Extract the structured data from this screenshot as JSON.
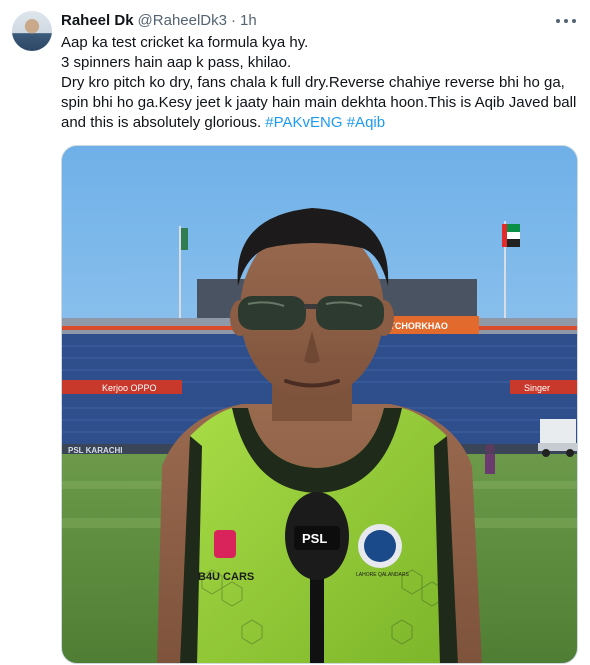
{
  "tweet": {
    "author_name": "Raheel Dk",
    "author_handle": "@RaheelDk3",
    "separator": "·",
    "time": "1h",
    "lines": [
      "Aap ka test cricket ka formula kya hy.",
      "3 spinners hain aap k pass, khilao.",
      "Dry kro pitch ko dry, fans chala k full dry.Reverse chahiye reverse bhi ho ga, spin bhi ho ga.Kesy jeet k jaaty hain main dekhta hoon.This is Aqib Javed ball and this is absolutely glorious."
    ],
    "hashtags": [
      "#PAKvENG",
      "#Aqib"
    ]
  },
  "media": {
    "stand_banner": "#MATCHORKHAO",
    "ad_board_left": "Kerjoo OPPO",
    "ad_board_right": "Singer",
    "ground_board": "PSL KARACHI",
    "microphone_label": "PSL",
    "jersey_sponsor": "B4U CARS",
    "jersey_badge": "LAHORE QALANDARS"
  },
  "colors": {
    "hashtag": "#1d9bf0",
    "secondary_text": "#536471",
    "border": "#cfd9de",
    "jersey": "#9ad13a"
  }
}
